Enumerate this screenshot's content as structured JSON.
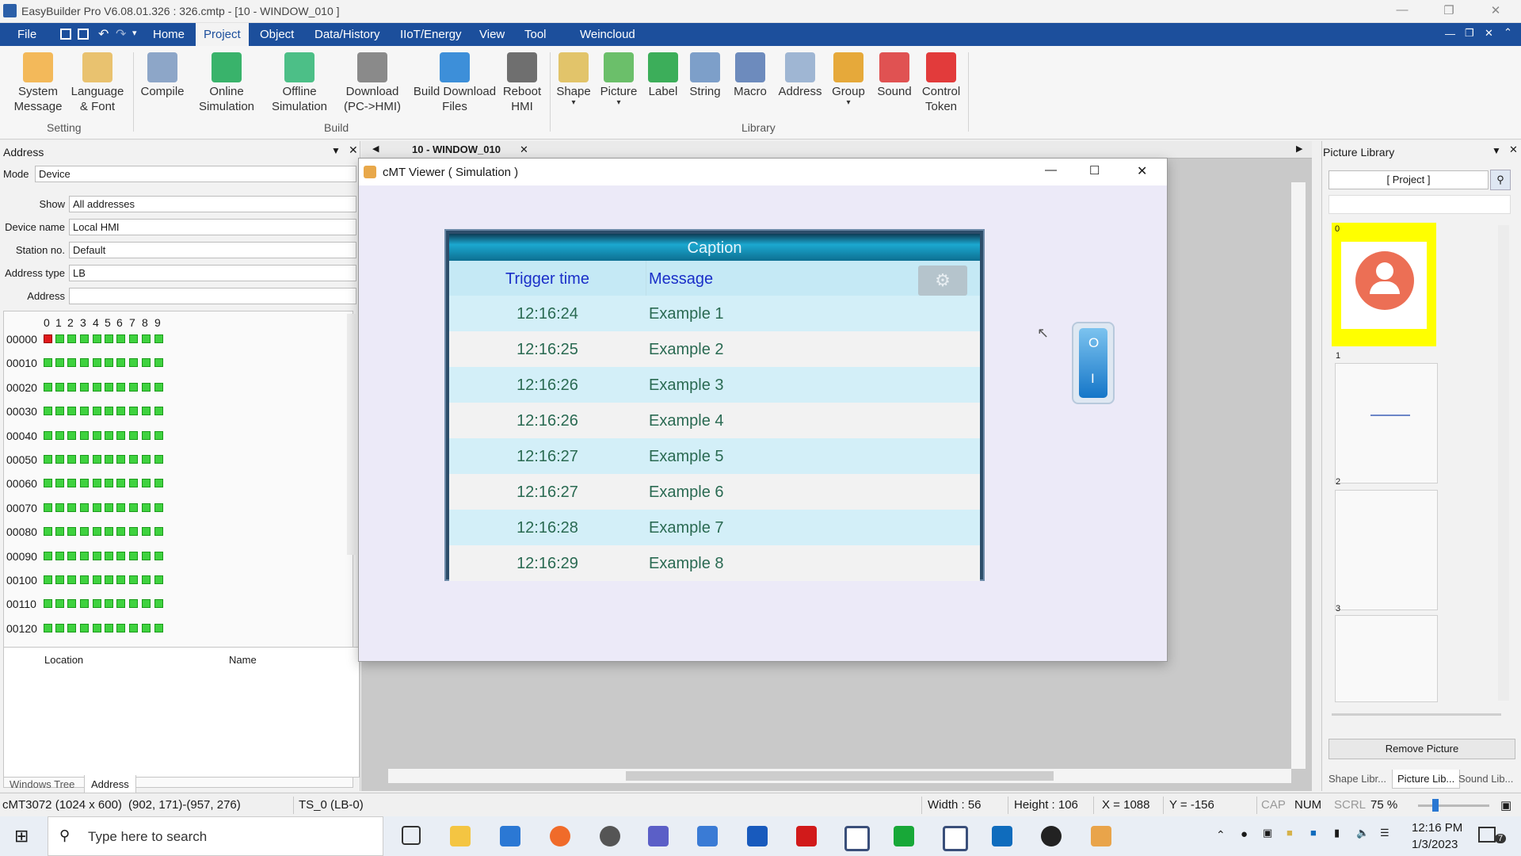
{
  "app": {
    "title": "EasyBuilder Pro V6.08.01.326 : 326.cmtp - [10 - WINDOW_010 ]",
    "window_controls": [
      "minimize-icon",
      "restore-icon",
      "close-icon"
    ]
  },
  "menu": {
    "items": [
      "File",
      "Home",
      "Project",
      "Object",
      "Data/History",
      "IIoT/Energy",
      "View",
      "Tool",
      "Weincloud"
    ],
    "active": "Project"
  },
  "ribbon": {
    "setting": {
      "label": "Setting",
      "buttons": [
        "System\nMessage",
        "Language\n& Font"
      ]
    },
    "build": {
      "label": "Build",
      "buttons": [
        "Compile",
        "Online\nSimulation",
        "Offline\nSimulation",
        "Download\n(PC->HMI)",
        "Build Download\nFiles",
        "Reboot\nHMI"
      ]
    },
    "library": {
      "label": "Library",
      "buttons": [
        "Shape",
        "Picture",
        "Label",
        "String",
        "Macro",
        "Address",
        "Group",
        "Sound",
        "Control\nToken"
      ]
    }
  },
  "address_panel": {
    "title": "Address",
    "mode_label": "Mode",
    "mode_value": "Device",
    "fields": [
      {
        "label": "Show",
        "value": "All addresses"
      },
      {
        "label": "Device name",
        "value": "Local HMI"
      },
      {
        "label": "Station no.",
        "value": "Default"
      },
      {
        "label": "Address type",
        "value": "LB"
      },
      {
        "label": "Address",
        "value": ""
      }
    ],
    "grid_columns": [
      "0",
      "1",
      "2",
      "3",
      "4",
      "5",
      "6",
      "7",
      "8",
      "9"
    ],
    "grid_rows": [
      "00000",
      "00010",
      "00020",
      "00030",
      "00040",
      "00050",
      "00060",
      "00070",
      "00080",
      "00090",
      "00100",
      "00110",
      "00120"
    ],
    "on_bits": [
      "00000-0"
    ],
    "list_headers": [
      "Location",
      "Name"
    ],
    "bottom_tabs": [
      "Windows Tree",
      "Address"
    ],
    "active_tab": "Address"
  },
  "editor_tab": {
    "label": "10 - WINDOW_010"
  },
  "viewer": {
    "title": "cMT Viewer ( Simulation )",
    "alarm": {
      "caption": "Caption",
      "headers": [
        "Trigger time",
        "Message"
      ],
      "rows": [
        {
          "time": "12:16:24",
          "message": "Example 1"
        },
        {
          "time": "12:16:25",
          "message": "Example 2"
        },
        {
          "time": "12:16:26",
          "message": "Example 3"
        },
        {
          "time": "12:16:26",
          "message": "Example 4"
        },
        {
          "time": "12:16:27",
          "message": "Example 5"
        },
        {
          "time": "12:16:27",
          "message": "Example 6"
        },
        {
          "time": "12:16:28",
          "message": "Example 7"
        },
        {
          "time": "12:16:29",
          "message": "Example 8"
        }
      ]
    },
    "switch": {
      "top_label": "O",
      "bottom_label": "I"
    }
  },
  "picture_library": {
    "title": "Picture Library",
    "category": "[ Project ]",
    "thumbs": [
      "0",
      "1",
      "2",
      "3"
    ],
    "remove_label": "Remove Picture",
    "bottom_tabs": [
      "Shape Libr...",
      "Picture Lib...",
      "Sound Lib..."
    ],
    "active_tab": "Picture Lib..."
  },
  "status": {
    "model": "cMT3072 (1024 x 600)",
    "coords": "(902, 171)-(957, 276)",
    "tag": "TS_0 (LB-0)",
    "width": "Width : 56",
    "height": "Height : 106",
    "x": "X = 1088",
    "y": "Y = -156",
    "cap": "CAP",
    "num": "NUM",
    "scrl": "SCRL",
    "zoom": "75 %"
  },
  "taskbar": {
    "search_placeholder": "Type here to search",
    "time": "12:16 PM",
    "date": "1/3/2023",
    "notification_count": "7"
  },
  "colors": {
    "menu_bg": "#1c4f9c",
    "bit_on": "#e0181b",
    "bit_off": "#3fd23f",
    "alarm_header": "#1a2fc8"
  }
}
